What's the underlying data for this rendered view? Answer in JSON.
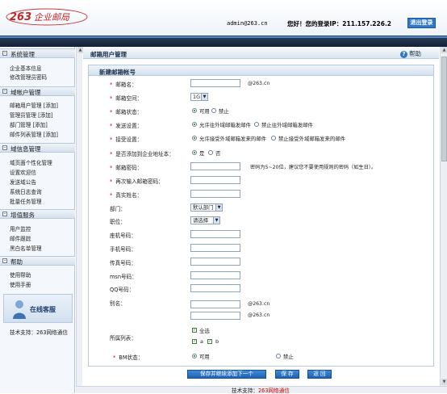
{
  "header": {
    "logo_text": "263企业邮局",
    "user": "admin@263.cn",
    "greeting": "您好！您的登录IP：211.157.226.2",
    "logout": "退出登录"
  },
  "sidebar": {
    "sections": [
      {
        "title": "系统管理",
        "items": [
          "企业基本信息",
          "修改管理员密码"
        ]
      },
      {
        "title": "域帐户管理",
        "items": [
          "邮箱用户管理 [添加]",
          "管理员管理   [添加]",
          "部门管理     [添加]",
          "邮件列表管理 [添加]"
        ]
      },
      {
        "title": "域信息管理",
        "items": [
          "域页面个性化管理",
          "设置欢迎信",
          "发送域公告",
          "系统日志查询",
          "批量任务管理"
        ]
      },
      {
        "title": "增值服务",
        "items": [
          "用户监控",
          "邮件跟踪",
          "黑白名单管理"
        ]
      },
      {
        "title": "帮助",
        "items": [
          "使用帮助",
          "使用手册"
        ]
      }
    ],
    "service_label": "在线客服",
    "support": "技术支持：263网络通信"
  },
  "main": {
    "title": "邮箱用户管理",
    "help": "帮助",
    "form_title": "新建邮箱帐号",
    "fields": {
      "mailbox_name": "邮箱名：",
      "mailbox_suffix": "@263.cn",
      "space": "邮箱空间：",
      "space_value": "1G",
      "status": "邮箱状态：",
      "status_on": "可用",
      "status_off": "禁止",
      "send": "发送设置：",
      "send_on": "允许往外域邮箱发邮件",
      "send_off": "禁止往外域邮箱发邮件",
      "recv": "接受设置：",
      "recv_on": "允许接受外域邮箱发来的邮件",
      "recv_off": "禁止接受外域邮箱发来的邮件",
      "addrbook": "是否添加到企业地址本：",
      "addrbook_yes": "是",
      "addrbook_no": "否",
      "password": "邮箱密码：",
      "password_hint": "密码为5~20位，建议您不要使用规则的密码（如生日）。",
      "password2": "再次输入邮箱密码：",
      "realname": "真实姓名：",
      "dept": "部门：",
      "dept_value": "默认部门",
      "position": "职位：",
      "position_value": "请选择",
      "phone": "座机号码：",
      "mobile": "手机号码：",
      "fax": "传真号码：",
      "msn": "msn号码：",
      "qq": "QQ号码：",
      "alias": "别名：",
      "alias_suffix1": "@263.cn",
      "alias_suffix2": "@263.cn",
      "lists": "所属列表：",
      "list_all": "全选",
      "list_a": "a",
      "list_b": "b",
      "bm_status": "BM状态：",
      "bm_on": "可用",
      "bm_off": "禁止"
    },
    "buttons": {
      "save_continue": "保存并继续添加下一个",
      "save": "保 存",
      "back": "返 回"
    }
  },
  "footer": {
    "label": "技术支持：",
    "company": "263网络通信"
  }
}
